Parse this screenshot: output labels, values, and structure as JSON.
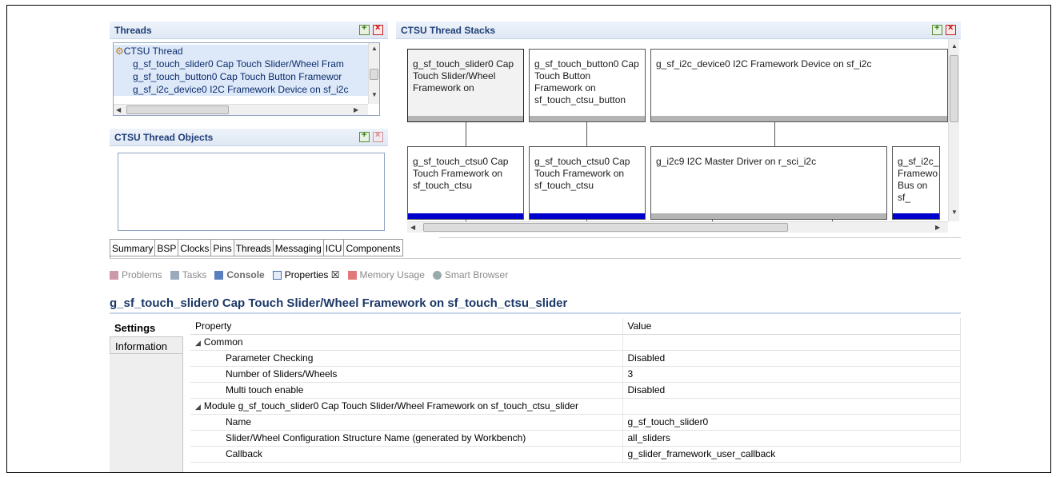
{
  "threads": {
    "title": "Threads",
    "root": "CTSU Thread",
    "items": [
      "g_sf_touch_slider0 Cap Touch Slider/Wheel Fram",
      "g_sf_touch_button0 Cap Touch Button Framewor",
      "g_sf_i2c_device0 I2C Framework Device on sf_i2c"
    ]
  },
  "thread_objects": {
    "title": "CTSU Thread Objects"
  },
  "stacks": {
    "title": "CTSU Thread Stacks",
    "row1": [
      "g_sf_touch_slider0 Cap Touch Slider/Wheel Framework on",
      "g_sf_touch_button0 Cap Touch Button Framework on sf_touch_ctsu_button",
      "g_sf_i2c_device0 I2C Framework Device on sf_i2c"
    ],
    "row2": [
      "g_sf_touch_ctsu0 Cap Touch Framework on sf_touch_ctsu",
      "g_sf_touch_ctsu0 Cap Touch Framework on sf_touch_ctsu",
      "g_i2c9 I2C Master Driver on r_sci_i2c",
      "g_sf_i2c_b Framewo Bus on sf_"
    ]
  },
  "tabs": [
    "Summary",
    "BSP",
    "Clocks",
    "Pins",
    "Threads",
    "Messaging",
    "ICU",
    "Components"
  ],
  "views": [
    {
      "label": "Problems",
      "icon": "problems-icon"
    },
    {
      "label": "Tasks",
      "icon": "tasks-icon"
    },
    {
      "label": "Console",
      "icon": "console-icon"
    },
    {
      "label": "Properties ☒",
      "icon": "properties-icon"
    },
    {
      "label": "Memory Usage",
      "icon": "memory-icon"
    },
    {
      "label": "Smart Browser",
      "icon": "smart-browser-icon"
    }
  ],
  "properties": {
    "title": "g_sf_touch_slider0 Cap Touch Slider/Wheel Framework on sf_touch_ctsu_slider",
    "side_tabs": [
      "Settings",
      "Information"
    ],
    "col_property": "Property",
    "col_value": "Value",
    "group_common": "Common",
    "common_rows": [
      {
        "name": "Parameter Checking",
        "value": "Disabled"
      },
      {
        "name": "Number of Sliders/Wheels",
        "value": "3"
      },
      {
        "name": "Multi touch enable",
        "value": "Disabled"
      }
    ],
    "group_module": "Module g_sf_touch_slider0 Cap Touch Slider/Wheel Framework on sf_touch_ctsu_slider",
    "module_rows": [
      {
        "name": "Name",
        "value": "g_sf_touch_slider0"
      },
      {
        "name": "Slider/Wheel Configuration Structure Name (generated by Workbench)",
        "value": "all_sliders"
      },
      {
        "name": "Callback",
        "value": "g_slider_framework_user_callback"
      }
    ]
  },
  "colors": {
    "accent_bar": "#0000cc",
    "grey_bar": "#b4b4b4",
    "header_text": "#1f3e77"
  }
}
